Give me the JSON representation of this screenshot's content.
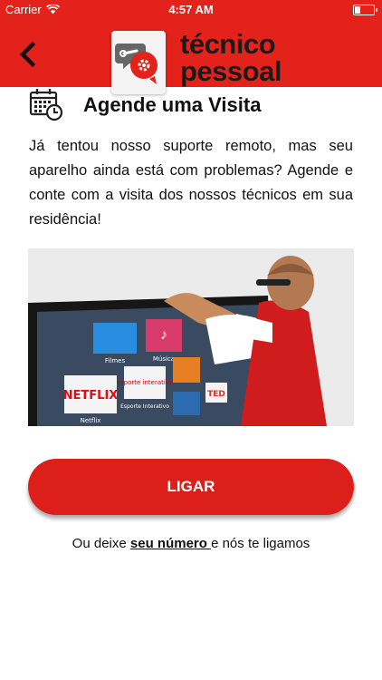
{
  "status_bar": {
    "carrier": "Carrier",
    "time": "4:57 AM"
  },
  "header": {
    "logo_line1": "técnico",
    "logo_line2": "pessoal"
  },
  "main": {
    "title": "Agende uma Visita",
    "description": "Já tentou nosso suporte remoto, mas seu aparelho ainda está com problemas? Agende e conte com a visita dos nossos técnicos em sua residência!",
    "tv_tiles": {
      "filmes": "Filmes",
      "musica": "Música",
      "netflix": "NETFLIX",
      "netflix_caption": "Netflix",
      "esporte": "esporte interativo",
      "esporte_caption": "Esporte Interativo",
      "ted": "TED"
    },
    "call_button_label": "LIGAR",
    "callback_prefix": "Ou deixe ",
    "callback_link": "seu número ",
    "callback_suffix": "e nós te ligamos"
  },
  "colors": {
    "brand_red": "#e3231b",
    "button_red": "#dc1f1a"
  }
}
